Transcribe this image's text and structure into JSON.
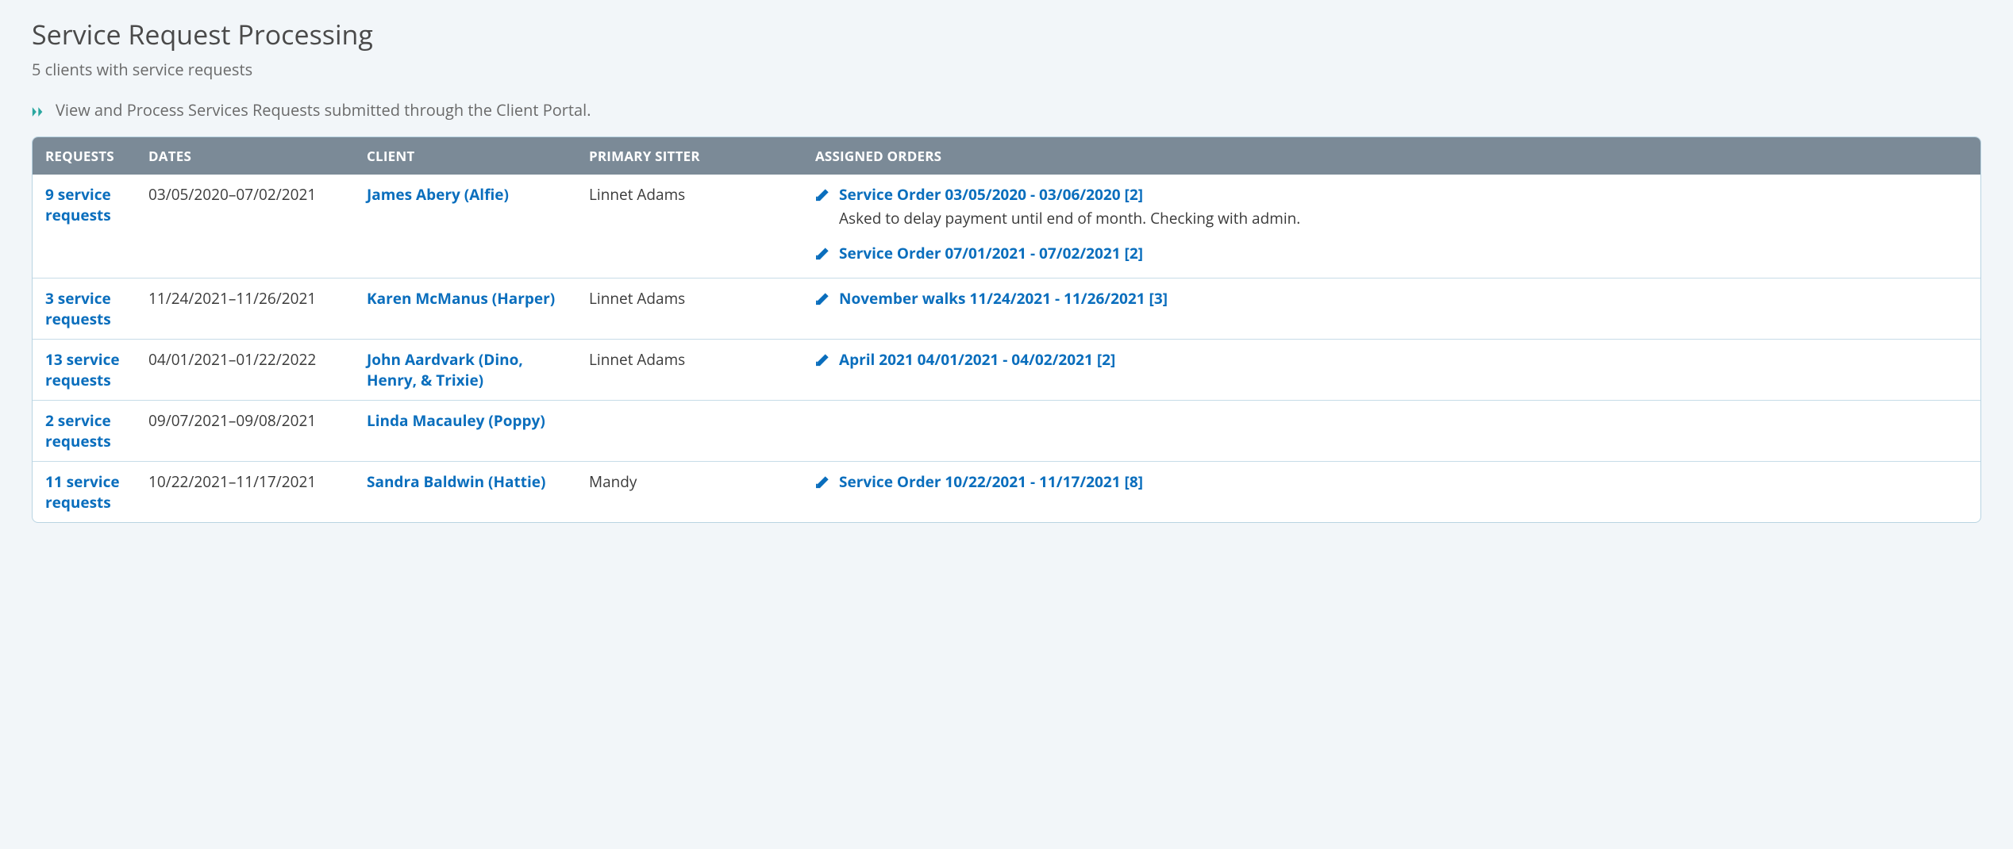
{
  "header": {
    "title": "Service Request Processing",
    "subtitle": "5 clients with service requests",
    "description": "View and Process Services Requests submitted through the Client Portal."
  },
  "table": {
    "columns": {
      "requests": "REQUESTS",
      "dates": "DATES",
      "client": "CLIENT",
      "sitter": "PRIMARY SITTER",
      "orders": "ASSIGNED ORDERS"
    },
    "rows": [
      {
        "requests": "9 service requests",
        "dates": "03/05/2020–07/02/2021",
        "client": "James Abery (Alfie)",
        "sitter": "Linnet Adams",
        "orders": [
          {
            "title": "Service Order 03/05/2020 - 03/06/2020 [2]",
            "note": "Asked to delay payment until end of month. Checking with admin."
          },
          {
            "title": "Service Order 07/01/2021 - 07/02/2021 [2]"
          }
        ]
      },
      {
        "requests": "3 service requests",
        "dates": "11/24/2021–11/26/2021",
        "client": "Karen McManus (Harper)",
        "sitter": "Linnet Adams",
        "orders": [
          {
            "title": "November walks 11/24/2021 - 11/26/2021 [3]"
          }
        ]
      },
      {
        "requests": "13 service requests",
        "dates": "04/01/2021–01/22/2022",
        "client": "John Aardvark (Dino, Henry, & Trixie)",
        "sitter": "Linnet Adams",
        "orders": [
          {
            "title": "April 2021 04/01/2021 - 04/02/2021 [2]"
          }
        ]
      },
      {
        "requests": "2 service requests",
        "dates": "09/07/2021–09/08/2021",
        "client": "Linda Macauley (Poppy)",
        "sitter": "",
        "orders": []
      },
      {
        "requests": "11 service requests",
        "dates": "10/22/2021–11/17/2021",
        "client": "Sandra Baldwin (Hattie)",
        "sitter": "Mandy",
        "orders": [
          {
            "title": "Service Order 10/22/2021 - 11/17/2021 [8]"
          }
        ]
      }
    ]
  }
}
